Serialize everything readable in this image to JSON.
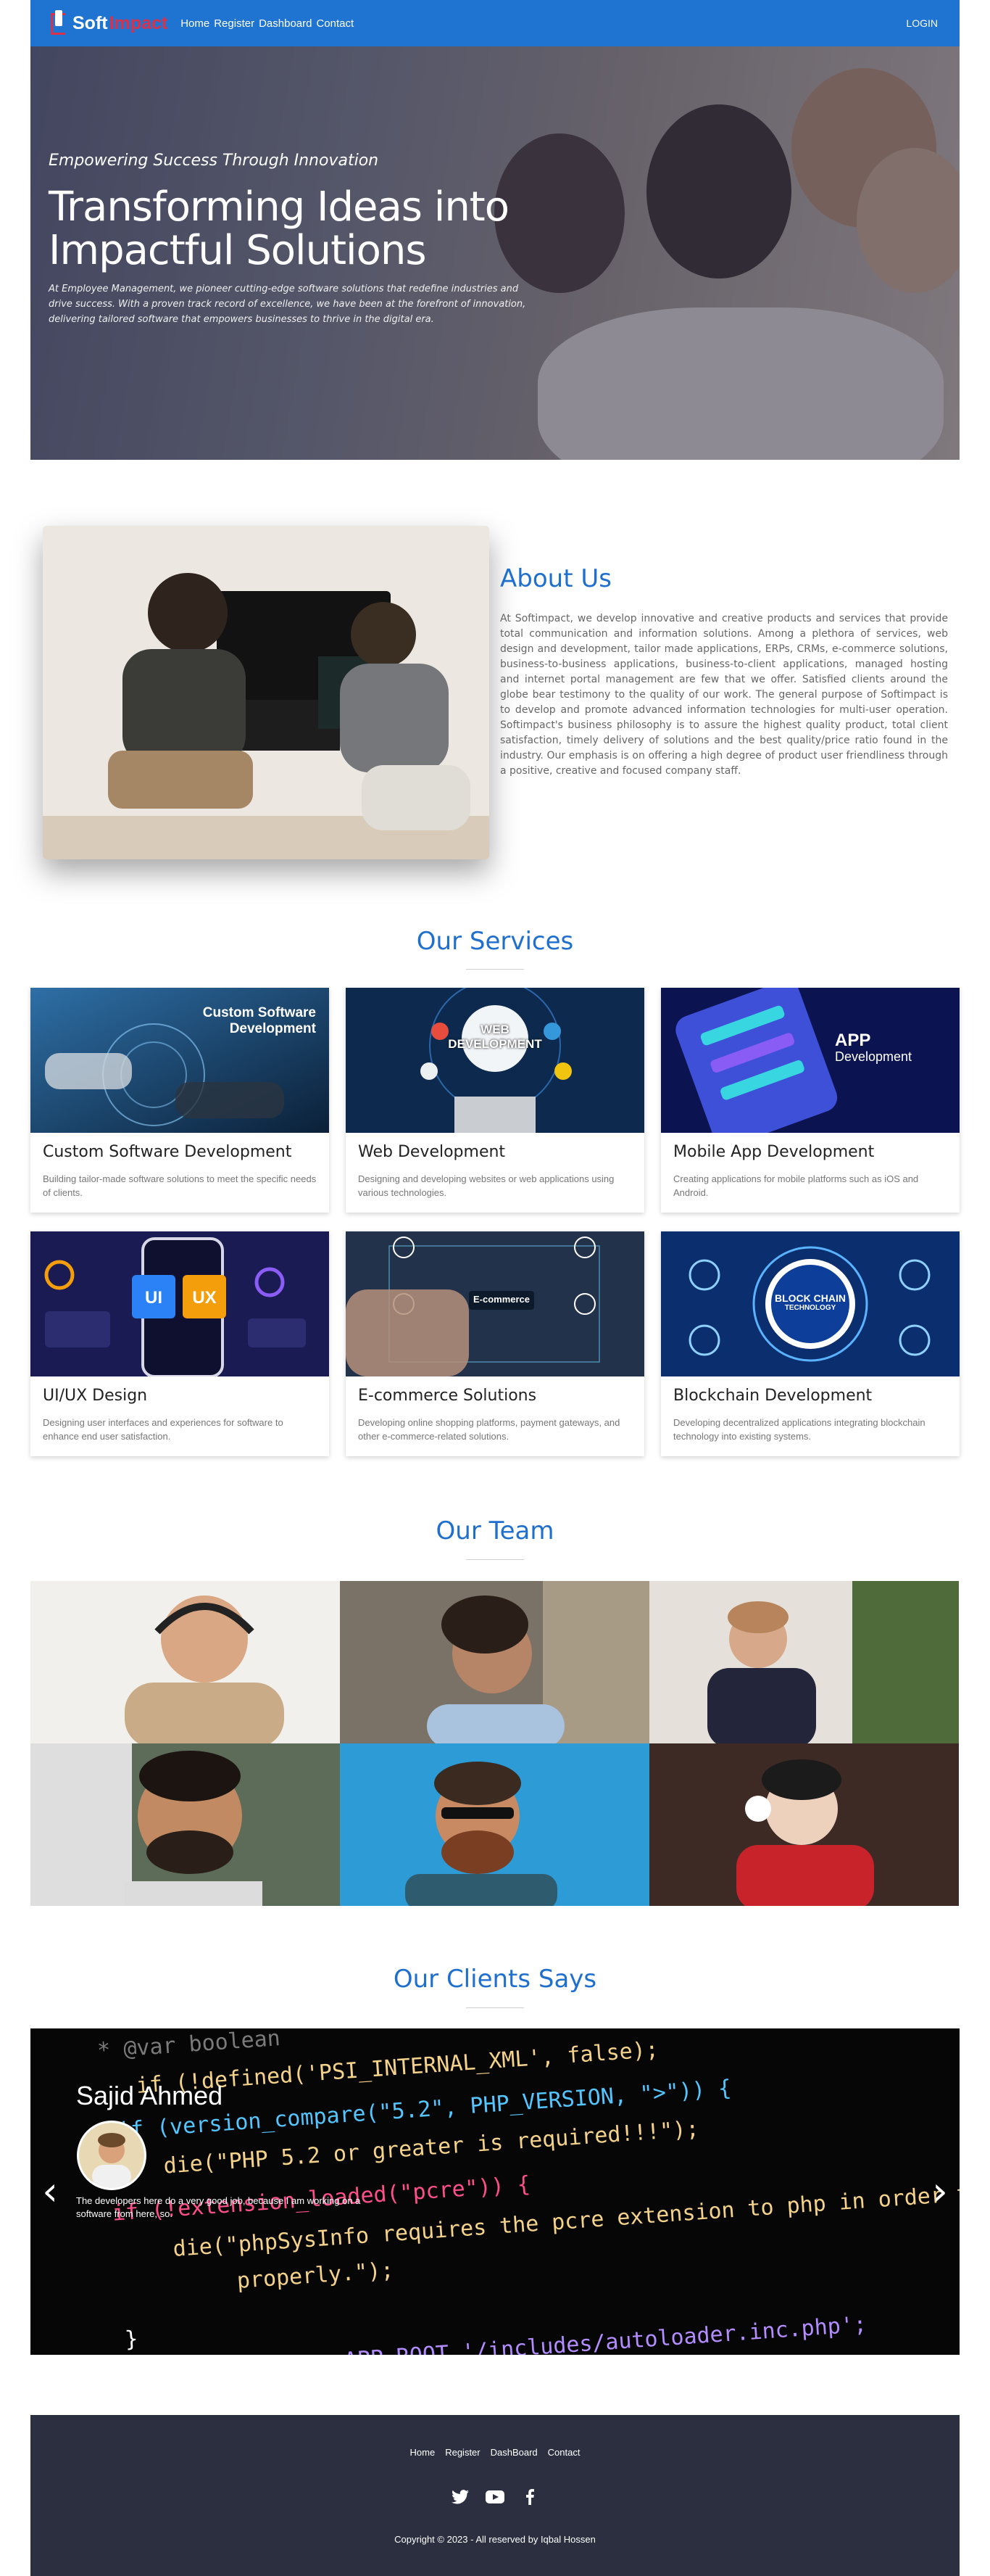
{
  "nav": {
    "brand_first": "Soft",
    "brand_second": "Impact",
    "links": [
      "Home",
      "Register",
      "Dashboard",
      "Contact"
    ],
    "login": "LOGIN"
  },
  "hero": {
    "kicker": "Empowering Success Through Innovation",
    "title": "Transforming Ideas into Impactful Solutions",
    "description": "At Employee Management, we pioneer cutting-edge software solutions that redefine industries and drive success. With a proven track record of excellence, we have been at the forefront of innovation, delivering tailored software that empowers businesses to thrive in the digital era."
  },
  "about": {
    "title": "About Us",
    "text": "At Softimpact, we develop innovative and creative products and services that provide total communication and information solutions. Among a plethora of services, web design and development, tailor made applications, ERPs, CRMs, e-commerce solutions, business-to-business applications, business-to-client applications, managed hosting and internet portal management are few that we offer. Satisfied clients around the globe bear testimony to the quality of our work. The general purpose of Softimpact is to develop and promote advanced information technologies for multi-user operation. Softimpact's business philosophy is to assure the highest quality product, total client satisfaction, timely delivery of solutions and the best quality/price ratio found in the industry. Our emphasis is on offering a high degree of product user friendliness through a positive, creative and focused company staff."
  },
  "services": {
    "title": "Our Services",
    "items": [
      {
        "title": "Custom Software Development",
        "desc": "Building tailor-made software solutions to meet the specific needs of clients.",
        "img_caption_1": "Custom Software",
        "img_caption_2": "Development"
      },
      {
        "title": "Web Development",
        "desc": "Designing and developing websites or web applications using various technologies.",
        "img_caption_1": "WEB",
        "img_caption_2": "DEVELOPMENT"
      },
      {
        "title": "Mobile App Development",
        "desc": "Creating applications for mobile platforms such as iOS and Android.",
        "img_caption_1": "APP",
        "img_caption_2": "Development"
      },
      {
        "title": "UI/UX Design",
        "desc": "Designing user interfaces and experiences for software to enhance end user satisfaction.",
        "img_caption_1": "UI",
        "img_caption_2": "UX"
      },
      {
        "title": "E-commerce Solutions",
        "desc": "Developing online shopping platforms, payment gateways, and other e-commerce-related solutions.",
        "img_caption_1": "E-commerce",
        "img_caption_2": ""
      },
      {
        "title": "Blockchain Development",
        "desc": "Developing decentralized applications integrating blockchain technology into existing systems.",
        "img_caption_1": "BLOCK CHAIN",
        "img_caption_2": "TECHNOLOGY"
      }
    ]
  },
  "team": {
    "title": "Our Team"
  },
  "clients": {
    "title": "Our Clients Says",
    "name": "Sajid Ahmed",
    "quote": "The developers here do a very good job, because I am working on a software from here, so.",
    "code_lines": [
      "* @var boolean",
      "if (!defined('PSI_INTERNAL_XML', false);",
      "if (version_compare(\"5.2\", PHP_VERSION, \">\")) {",
      "die(\"PHP 5.2 or greater is required!!!\");",
      "if (!extension_loaded(\"pcre\")) {",
      "die(\"phpSysInfo requires the pcre extension to php in order to work",
      "properly.\");",
      "}",
      "APP_ROOT.'/includes/autoloader.inc.php';"
    ]
  },
  "footer": {
    "links": [
      "Home",
      "Register",
      "DashBoard",
      "Contact"
    ],
    "social": [
      "twitter-icon",
      "youtube-icon",
      "facebook-icon"
    ],
    "copyright": "Copyright © 2023 - All reserved by Iqbal Hossen"
  }
}
